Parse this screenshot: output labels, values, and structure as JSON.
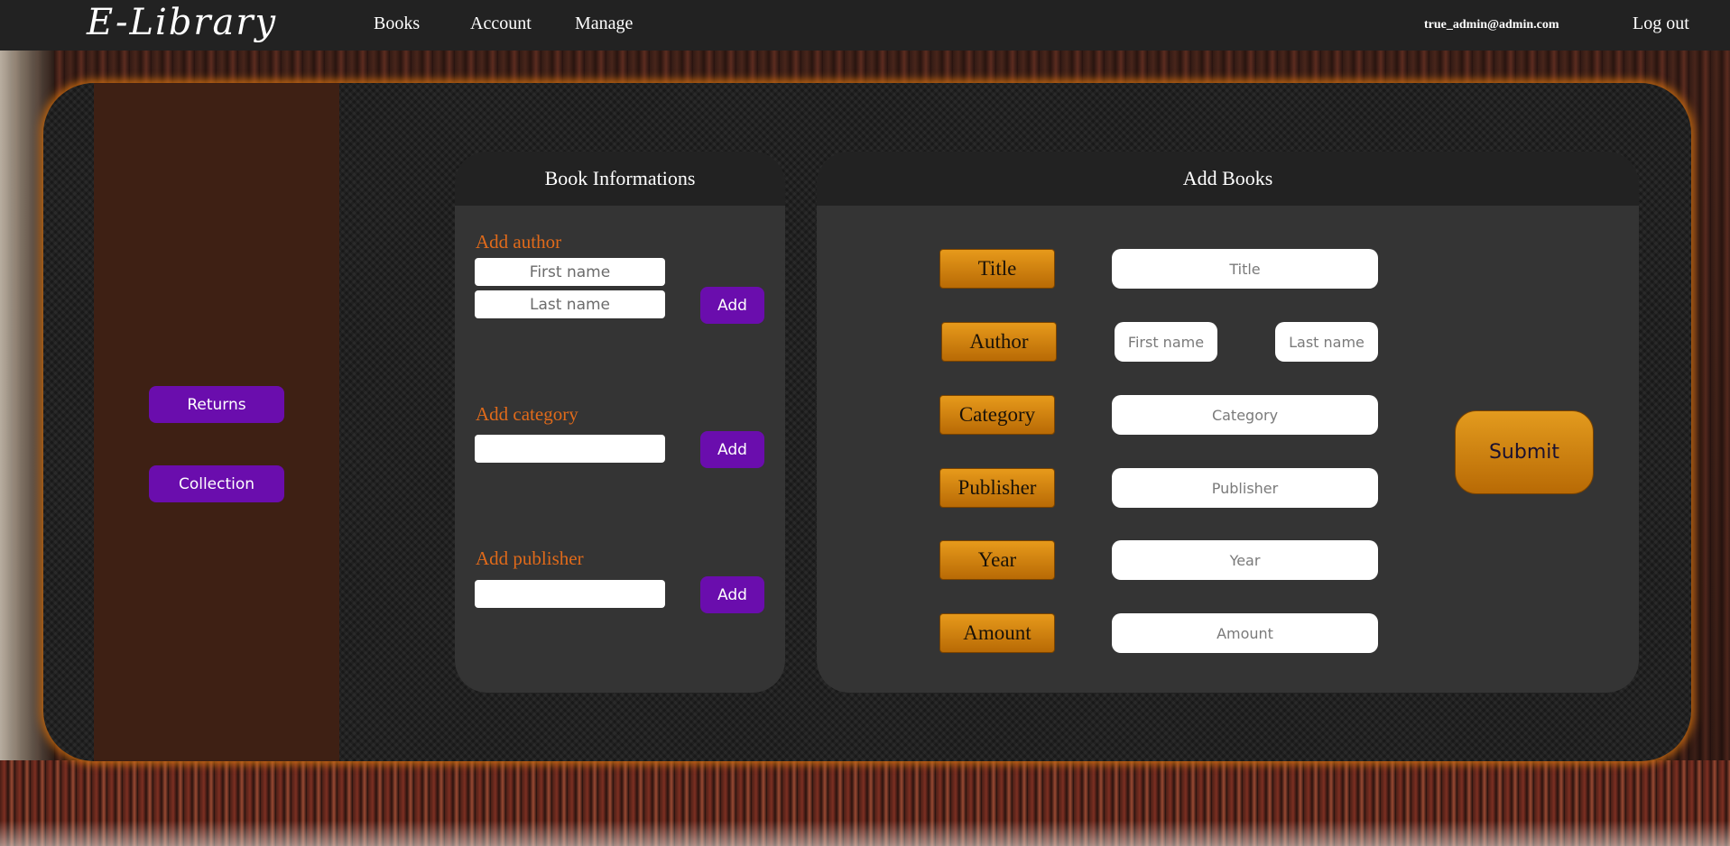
{
  "navbar": {
    "logo": "E-Library",
    "links": [
      "Books",
      "Account",
      "Manage"
    ],
    "user_email": "true_admin@admin.com",
    "logout": "Log out"
  },
  "sidebar": {
    "buttons": [
      "Returns",
      "Collection"
    ]
  },
  "book_info": {
    "title": "Book Informations",
    "add_author_label": "Add author",
    "first_name_placeholder": "First name",
    "last_name_placeholder": "Last name",
    "add_category_label": "Add category",
    "add_publisher_label": "Add publisher",
    "add_button": "Add"
  },
  "add_books": {
    "title": "Add Books",
    "fields": {
      "title": {
        "label": "Title",
        "placeholder": "Title"
      },
      "author": {
        "label": "Author",
        "first_placeholder": "First name",
        "last_placeholder": "Last name"
      },
      "category": {
        "label": "Category",
        "placeholder": "Category"
      },
      "publisher": {
        "label": "Publisher",
        "placeholder": "Publisher"
      },
      "year": {
        "label": "Year",
        "placeholder": "Year"
      },
      "amount": {
        "label": "Amount",
        "placeholder": "Amount"
      }
    },
    "submit": "Submit"
  },
  "colors": {
    "accent_purple": "#6a0dad",
    "accent_orange": "#e06a1a",
    "gold": "#d88a10",
    "sidebar_brown": "#3e2014"
  }
}
